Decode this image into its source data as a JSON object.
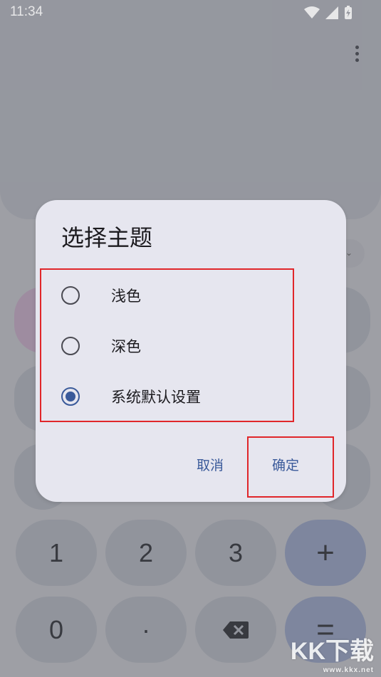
{
  "status_bar": {
    "time": "11:34"
  },
  "keypad": {
    "row1": [
      "1",
      "2",
      "3",
      "+"
    ],
    "row2": [
      "0",
      "·",
      "⌫",
      "="
    ]
  },
  "dialog": {
    "title": "选择主题",
    "options": [
      {
        "label": "浅色",
        "selected": false
      },
      {
        "label": "深色",
        "selected": false
      },
      {
        "label": "系统默认设置",
        "selected": true
      }
    ],
    "cancel_label": "取消",
    "ok_label": "确定"
  },
  "watermark": {
    "text": "KK下载",
    "url": "www.kkx.net"
  },
  "colors": {
    "accent": "#3a5a9a",
    "highlight": "#e0262a",
    "dialog_bg": "#e6e6ef"
  }
}
